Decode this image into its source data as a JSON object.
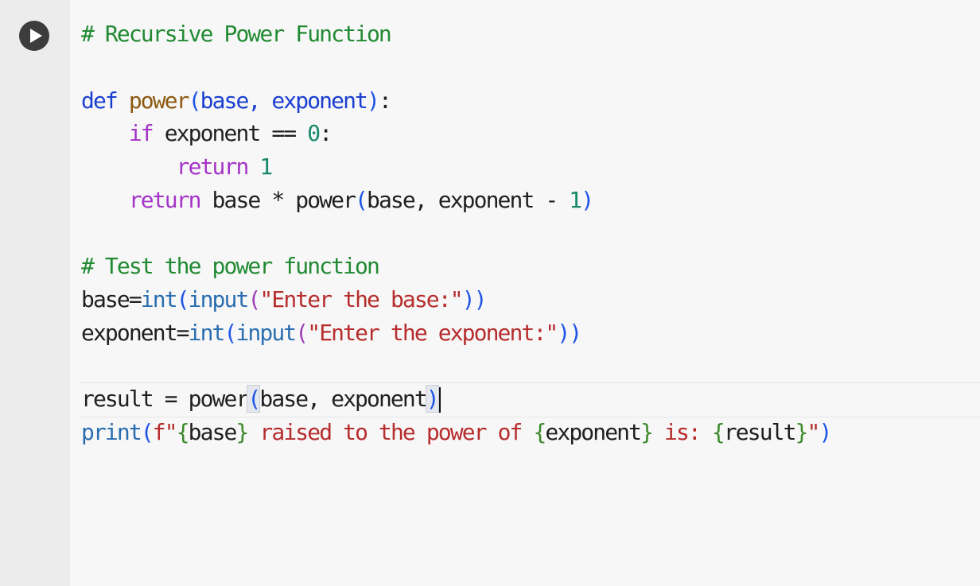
{
  "cell": {
    "run_icon": "play-icon",
    "colors": {
      "comment": "#218a32",
      "keyword": "#1a3fd1",
      "control": "#a433c7",
      "builtin": "#2a6eb0",
      "number": "#178a6a",
      "string": "#b72c2c",
      "paren": "#1f55e6"
    },
    "code": {
      "l1": {
        "comment": "# Recursive Power Function"
      },
      "l3": {
        "kw": "def",
        "sp1": " ",
        "fn": "power",
        "op": "(",
        "args": "base, exponent",
        "cp": ")",
        "colon": ":"
      },
      "l4": {
        "indent": "    ",
        "kw": "if",
        "rest": " exponent == ",
        "num": "0",
        "colon": ":"
      },
      "l5": {
        "indent": "        ",
        "kw": "return",
        "sp": " ",
        "num": "1"
      },
      "l6": {
        "indent": "    ",
        "kw": "return",
        "rest": " base * power",
        "op": "(",
        "args": "base, exponent - ",
        "num": "1",
        "cp": ")"
      },
      "l8": {
        "comment": "# Test the power function"
      },
      "l9": {
        "lhs": "base=",
        "int": "int",
        "op1": "(",
        "input": "input",
        "op2": "(",
        "str": "\"Enter the base:\"",
        "cp": "))"
      },
      "l10": {
        "lhs": "exponent=",
        "int": "int",
        "op1": "(",
        "input": "input",
        "op2": "(",
        "str": "\"Enter the exponent:\"",
        "cp": "))"
      },
      "l12": {
        "lhs": "result = power",
        "op": "(",
        "args": "base, exponent",
        "cp": ")"
      },
      "l13": {
        "print": "print",
        "op": "(",
        "fstart": "f\"",
        "b1o": "{",
        "v1": "base",
        "b1c": "}",
        "s1": " raised to the power of ",
        "b2o": "{",
        "v2": "exponent",
        "b2c": "}",
        "s2": " is: ",
        "b3o": "{",
        "v3": "result",
        "b3c": "}",
        "fend": "\"",
        "cp": ")"
      }
    }
  }
}
